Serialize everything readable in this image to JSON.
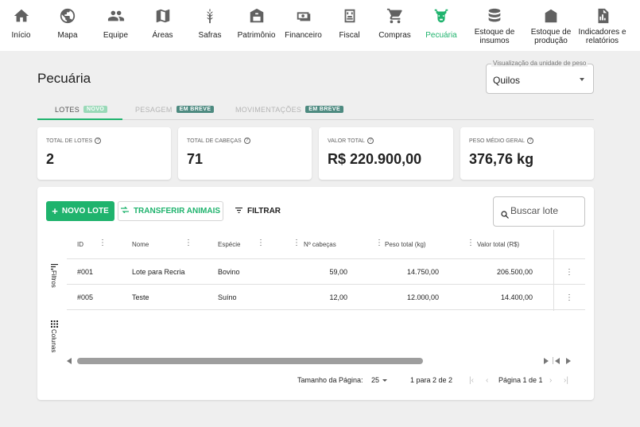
{
  "nav": [
    {
      "key": "inicio",
      "label": "Início",
      "icon": "home-icon"
    },
    {
      "key": "mapa",
      "label": "Mapa",
      "icon": "globe-icon"
    },
    {
      "key": "equipe",
      "label": "Equipe",
      "icon": "people-icon"
    },
    {
      "key": "areas",
      "label": "Áreas",
      "icon": "map-icon"
    },
    {
      "key": "safras",
      "label": "Safras",
      "icon": "wheat-icon"
    },
    {
      "key": "patrimonio",
      "label": "Patrimônio",
      "icon": "barn-icon"
    },
    {
      "key": "financeiro",
      "label": "Financeiro",
      "icon": "money-icon"
    },
    {
      "key": "fiscal",
      "label": "Fiscal",
      "icon": "invoice-icon"
    },
    {
      "key": "compras",
      "label": "Compras",
      "icon": "cart-icon"
    },
    {
      "key": "pecuaria",
      "label": "Pecuária",
      "icon": "cow-icon"
    },
    {
      "key": "estoque_insumos",
      "label": "Estoque de insumos",
      "icon": "database-icon"
    },
    {
      "key": "estoque_producao",
      "label": "Estoque de produção",
      "icon": "silo-icon"
    },
    {
      "key": "indicadores",
      "label": "Indicadores e relatórios",
      "icon": "report-icon"
    }
  ],
  "active_nav": "pecuaria",
  "accent_color": "#1fb36d",
  "page": {
    "title": "Pecuária"
  },
  "unit_select": {
    "legend": "Visualização da unidade de peso",
    "value": "Quilos"
  },
  "tabs": [
    {
      "label": "LOTES",
      "badge": "NOVO",
      "badge_color": "#9ad9b8",
      "active": true
    },
    {
      "label": "PESAGEM",
      "badge": "EM BREVE",
      "badge_color": "#4d8a80",
      "active": false
    },
    {
      "label": "MOVIMENTAÇÕES",
      "badge": "EM BREVE",
      "badge_color": "#4d8a80",
      "active": false
    }
  ],
  "stats": [
    {
      "label": "TOTAL DE LOTES",
      "value": "2"
    },
    {
      "label": "TOTAL DE CABEÇAS",
      "value": "71"
    },
    {
      "label": "VALOR TOTAL",
      "value": "R$ 220.900,00"
    },
    {
      "label": "PESO MÉDIO GERAL",
      "value": "376,76 kg"
    }
  ],
  "toolbar": {
    "new_label": "NOVO LOTE",
    "transfer_label": "TRANSFERIR ANIMAIS",
    "filter_label": "FILTRAR",
    "search_placeholder": "Buscar lote"
  },
  "side_tools": {
    "filters": "Filtros",
    "columns": "Colunas"
  },
  "grid": {
    "columns": [
      "ID",
      "Nome",
      "Espécie",
      "Nº cabeças",
      "Peso total (kg)",
      "Valor total (R$)"
    ],
    "rows": [
      [
        "#001",
        "Lote para Recria",
        "Bovino",
        "59,00",
        "14.750,00",
        "206.500,00"
      ],
      [
        "#005",
        "Teste",
        "Suíno",
        "12,00",
        "12.000,00",
        "14.400,00"
      ]
    ]
  },
  "pagination": {
    "page_size_label": "Tamanho da Página:",
    "page_size": "25",
    "range": "1 para 2 de 2",
    "page_info": "Página 1 de 1"
  }
}
